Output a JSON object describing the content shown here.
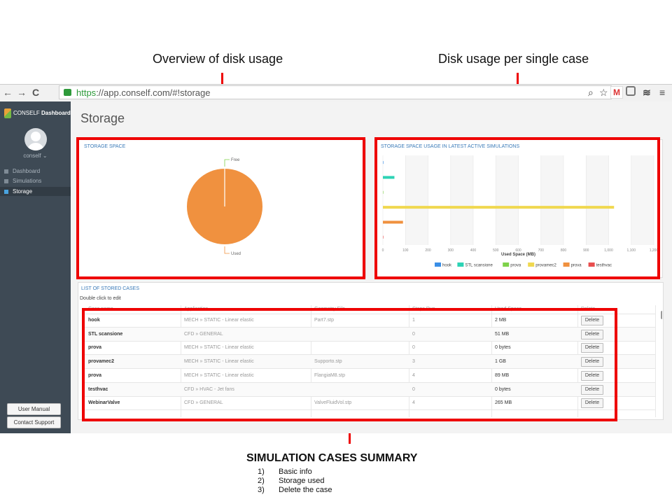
{
  "annotations": {
    "overview_title": "Overview of disk usage",
    "per_case_title": "Disk usage per single case",
    "summary_title": "SIMULATION CASES SUMMARY",
    "summary_items": [
      {
        "num": "1)",
        "text": "Basic info"
      },
      {
        "num": "2)",
        "text": "Storage used"
      },
      {
        "num": "3)",
        "text": "Delete the case"
      }
    ],
    "highlight_color": "#e00000"
  },
  "browser": {
    "back_icon": "←",
    "forward_icon": "→",
    "reload_icon": "C",
    "url_scheme": "https",
    "url_rest": "://app.conself.com/#!storage",
    "toolbar_icons": [
      "zoom-icon",
      "star-icon",
      "gmail-icon",
      "extension-icon",
      "buffer-icon",
      "menu-icon"
    ]
  },
  "sidebar": {
    "brand_prefix": "CONSELF",
    "brand_suffix": "Dashboard",
    "username": "conself ⌄",
    "nav": [
      {
        "label": "Dashboard",
        "icon": "home-icon",
        "active": false
      },
      {
        "label": "Simulations",
        "icon": "car-icon",
        "active": false
      },
      {
        "label": "Storage",
        "icon": "storage-icon",
        "active": true
      }
    ],
    "user_manual": "User Manual",
    "contact_support": "Contact Support"
  },
  "page": {
    "title": "Storage"
  },
  "storage_space": {
    "title": "STORAGE SPACE",
    "free_label": "Free",
    "used_label": "Used",
    "used_color": "#f0913f"
  },
  "chart_data": {
    "type": "bar",
    "orientation": "horizontal",
    "title": "STORAGE SPACE USAGE IN LATEST ACTIVE SIMULATIONS",
    "xlabel": "Used Space (MB)",
    "xlim": [
      0,
      1200
    ],
    "xticks": [
      "0",
      "100",
      "200",
      "300",
      "400",
      "500",
      "600",
      "700",
      "800",
      "900",
      "1,000",
      "1,100",
      "1,200"
    ],
    "series": [
      {
        "name": "hook",
        "value": 2,
        "color": "#3a8ee6"
      },
      {
        "name": "STL scansione",
        "value": 51,
        "color": "#2dd3b5"
      },
      {
        "name": "prova",
        "value": 0,
        "color": "#7ed24a"
      },
      {
        "name": "provamec2",
        "value": 1024,
        "color": "#f0d850"
      },
      {
        "name": "prova",
        "value": 89,
        "color": "#f0913f"
      },
      {
        "name": "testhvac",
        "value": 0,
        "color": "#e84e4e"
      }
    ],
    "grid": true,
    "legend": "bottom"
  },
  "cases": {
    "title": "LIST OF STORED CASES",
    "hint": "Double click to edit",
    "columns": [
      "Case name",
      "Application",
      "Geometry File",
      "Steps Run",
      "Used Space",
      "Delete"
    ],
    "rows": [
      {
        "name": "hook",
        "app": "MECH » STATIC - Linear elastic",
        "geom": "Part7.stp",
        "steps": "1",
        "space": "2 MB",
        "del": "Delete"
      },
      {
        "name": "STL scansione",
        "app": "CFD » GENERAL",
        "geom": "",
        "steps": "0",
        "space": "51 MB",
        "del": "Delete"
      },
      {
        "name": "prova",
        "app": "MECH » STATIC - Linear elastic",
        "geom": "",
        "steps": "0",
        "space": "0 bytes",
        "del": "Delete"
      },
      {
        "name": "provamec2",
        "app": "MECH » STATIC - Linear elastic",
        "geom": "Supporto.stp",
        "steps": "3",
        "space": "1 GB",
        "del": "Delete"
      },
      {
        "name": "prova",
        "app": "MECH » STATIC - Linear elastic",
        "geom": "FlangiaM8.stp",
        "steps": "4",
        "space": "89 MB",
        "del": "Delete"
      },
      {
        "name": "testhvac",
        "app": "CFD » HVAC - Jet fans",
        "geom": "",
        "steps": "0",
        "space": "0 bytes",
        "del": "Delete"
      },
      {
        "name": "WebinarValve",
        "app": "CFD » GENERAL",
        "geom": "ValveFluidVol.stp",
        "steps": "4",
        "space": "265 MB",
        "del": "Delete"
      }
    ]
  }
}
